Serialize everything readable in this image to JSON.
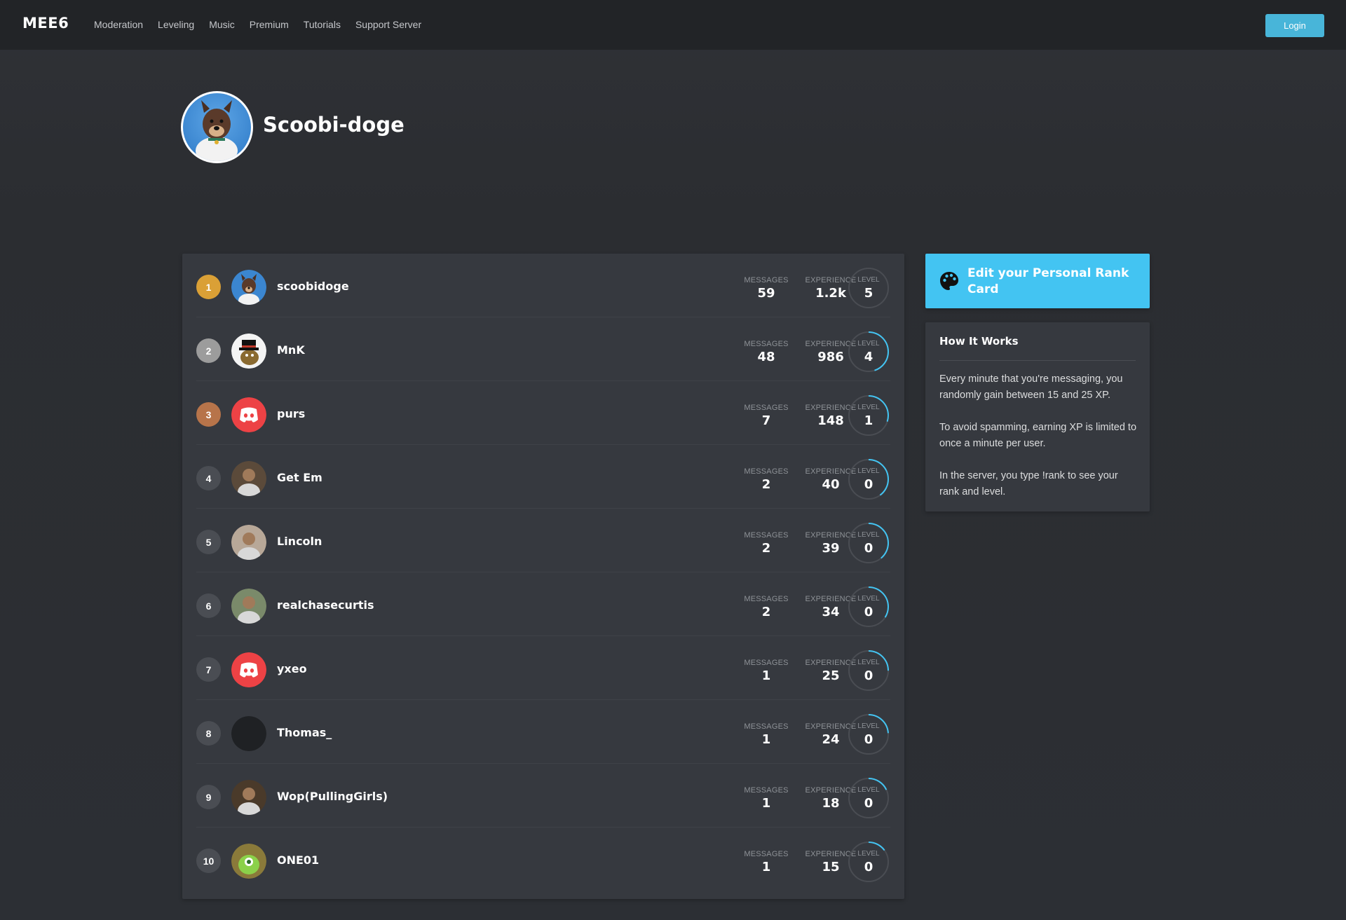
{
  "navbar": {
    "brand": "MEE6",
    "links": [
      "Moderation",
      "Leveling",
      "Music",
      "Premium",
      "Tutorials",
      "Support Server"
    ],
    "login_label": "Login"
  },
  "server": {
    "name": "Scoobi-doge",
    "avatar_icon": "dog-mascot-avatar"
  },
  "leaderboard": {
    "messages_label": "MESSAGES",
    "experience_label": "EXPERIENCE",
    "level_label": "LEVEL",
    "rows": [
      {
        "rank": "1",
        "username": "scoobidoge",
        "messages": "59",
        "experience": "1.2k",
        "level": "5",
        "progress": 0.0,
        "avatar": "dog-mascot-avatar",
        "rank_color": "gold"
      },
      {
        "rank": "2",
        "username": "MnK",
        "messages": "48",
        "experience": "986",
        "level": "4",
        "progress": 0.45,
        "avatar": "top-hat-character-avatar",
        "rank_color": "silver"
      },
      {
        "rank": "3",
        "username": "purs",
        "messages": "7",
        "experience": "148",
        "level": "1",
        "progress": 0.3,
        "avatar": "discord-default-avatar",
        "rank_color": "bronze"
      },
      {
        "rank": "4",
        "username": "Get Em",
        "messages": "2",
        "experience": "40",
        "level": "0",
        "progress": 0.4,
        "avatar": "photo-avatar",
        "rank_color": "default"
      },
      {
        "rank": "5",
        "username": "Lincoln",
        "messages": "2",
        "experience": "39",
        "level": "0",
        "progress": 0.39,
        "avatar": "photo-avatar",
        "rank_color": "default"
      },
      {
        "rank": "6",
        "username": "realchasecurtis",
        "messages": "2",
        "experience": "34",
        "level": "0",
        "progress": 0.34,
        "avatar": "photo-avatar",
        "rank_color": "default"
      },
      {
        "rank": "7",
        "username": "yxeo",
        "messages": "1",
        "experience": "25",
        "level": "0",
        "progress": 0.25,
        "avatar": "discord-default-avatar",
        "rank_color": "default"
      },
      {
        "rank": "8",
        "username": "Thomas_",
        "messages": "1",
        "experience": "24",
        "level": "0",
        "progress": 0.24,
        "avatar": "dark-avatar",
        "rank_color": "default"
      },
      {
        "rank": "9",
        "username": "Wop(PullingGirls)",
        "messages": "1",
        "experience": "18",
        "level": "0",
        "progress": 0.18,
        "avatar": "photo-avatar",
        "rank_color": "default"
      },
      {
        "rank": "10",
        "username": "ONE01",
        "messages": "1",
        "experience": "15",
        "level": "0",
        "progress": 0.15,
        "avatar": "green-character-avatar",
        "rank_color": "default"
      }
    ]
  },
  "sidebar": {
    "rank_card_button": "Edit your Personal Rank Card",
    "rank_card_icon": "palette-icon",
    "how_it_works": {
      "title": "How It Works",
      "paragraphs": [
        "Every minute that you're messaging, you randomly gain between 15 and 25 XP.",
        "To avoid spamming, earning XP is limited to once a minute per user.",
        "In the server, you type !rank to see your rank and level."
      ]
    }
  },
  "colors": {
    "accent": "#43c4f2",
    "login": "#48b5d9",
    "gold": "#daa036",
    "silver": "#9c9c9c",
    "bronze": "#b7744a",
    "progress": "#43c4f2",
    "discord_red": "#ed4245"
  }
}
